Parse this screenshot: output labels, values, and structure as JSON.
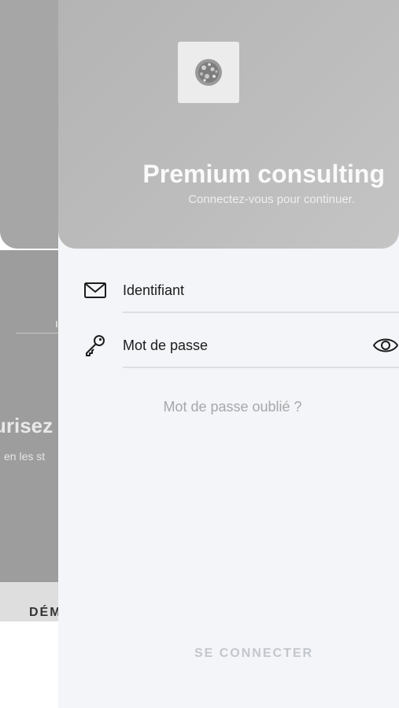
{
  "background": {
    "heading_fragment": "urisez",
    "sub_fragment": "en les st",
    "bottom_button_fragment": "DÉM"
  },
  "header": {
    "title": "Premium consulting",
    "subtitle": "Connectez-vous pour continuer."
  },
  "form": {
    "username_label": "Identifiant",
    "password_label": "Mot de passe",
    "forgot_password": "Mot de passe oublié ?",
    "submit_label": "SE CONNECTER"
  },
  "icons": {
    "username": "envelope-icon",
    "password": "key-icon",
    "toggle_visibility": "eye-icon",
    "logo": "logo-icon"
  },
  "colors": {
    "header_gray": "#b8b8b8",
    "sheet_bg": "#f3f5f9",
    "muted_text": "#a7a7a7",
    "disabled_button": "#c3c6cb"
  }
}
